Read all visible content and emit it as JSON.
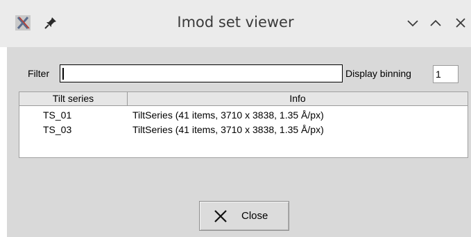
{
  "window": {
    "title": "Imod set viewer",
    "icons": [
      "app-x-icon",
      "pin-icon",
      "minimize-icon",
      "maximize-icon",
      "close-icon"
    ]
  },
  "filter": {
    "label": "Filter",
    "value": ""
  },
  "binning": {
    "label": "Display binning",
    "value": "1"
  },
  "table": {
    "headers": [
      "Tilt series",
      "Info"
    ],
    "rows": [
      {
        "name": "TS_01",
        "info": "TiltSeries (41 items, 3710 x 3838, 1.35 Å/px)"
      },
      {
        "name": "TS_03",
        "info": "TiltSeries (41 items, 3710 x 3838, 1.35 Å/px)"
      }
    ]
  },
  "close_button": {
    "label": "Close",
    "icon": "x-icon"
  }
}
